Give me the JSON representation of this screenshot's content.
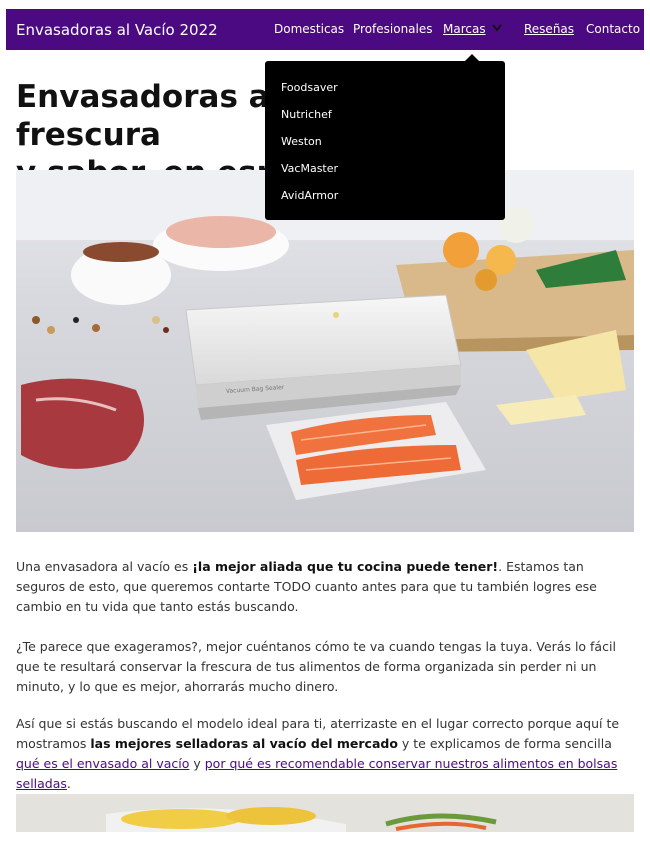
{
  "site": {
    "brand": "Envasadoras al Vacío 2022"
  },
  "nav": {
    "items": [
      "Domesticas",
      "Profesionales",
      "Marcas",
      "Reseñas",
      "Contacto"
    ]
  },
  "dropdown": {
    "items": [
      "Foodsaver",
      "Nutrichef",
      "Weston",
      "VacMaster",
      "AvidArmor"
    ]
  },
  "page": {
    "title_left": "Envasadoras al v",
    "title_right": "frescura",
    "title_line2": "y sabor, en espa"
  },
  "hero": {
    "machine_label": "Vacuum Bag Sealer"
  },
  "paragraphs": {
    "p1_a": "Una envasadora al vacío es ",
    "p1_b": "¡la mejor aliada que tu cocina puede tener!",
    "p1_c": ". Estamos tan seguros de esto, que queremos contarte TODO cuanto antes para que tu también logres ese cambio en tu vida que tanto estás buscando.",
    "p2": "¿Te parece que exageramos?, mejor cuéntanos cómo te va cuando tengas la tuya. Verás lo fácil que te resultará conservar la frescura de tus alimentos de forma organizada sin perder ni un minuto, y lo que es mejor, ahorrarás mucho dinero.",
    "p3_a": "Así que si estás buscando el modelo ideal para ti, aterrizaste en el lugar correcto porque aquí te mostramos ",
    "p3_b": "las mejores selladoras al vacío del mercado",
    "p3_c": " y te explicamos de forma sencilla ",
    "p3_link1": "qué es el envasado al vacío",
    "p3_d": " y ",
    "p3_link2": "por qué es recomendable conservar nuestros alimentos en bolsas selladas",
    "p3_e": "."
  },
  "colors": {
    "nav_bg": "#4b0a82",
    "dropdown_bg": "#000000",
    "link": "#4b0a82"
  }
}
